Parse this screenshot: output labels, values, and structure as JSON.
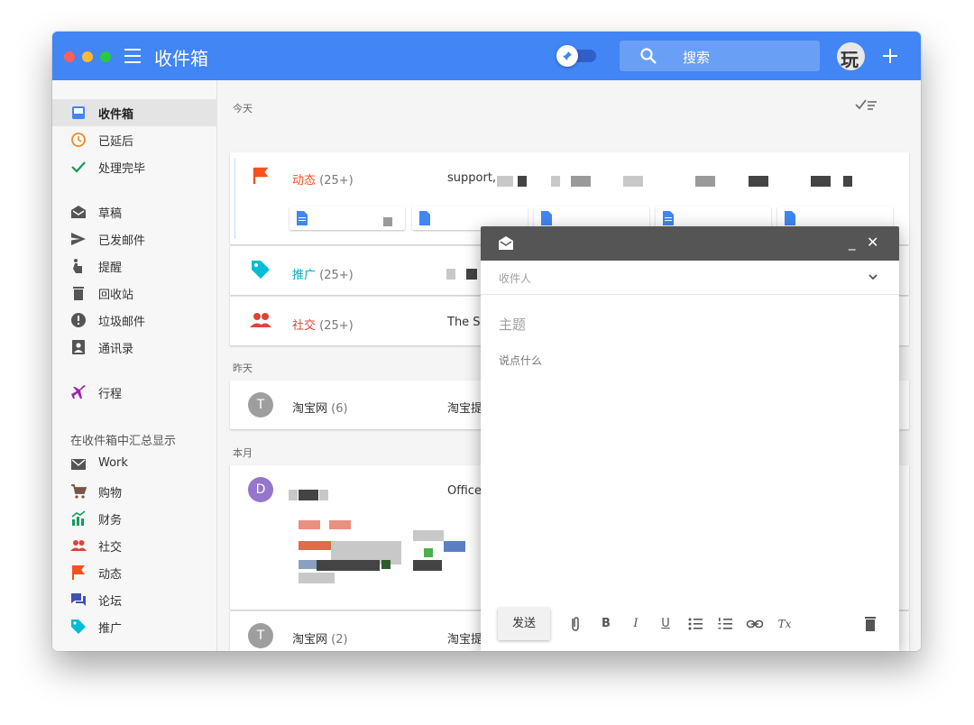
{
  "header": {
    "title": "收件箱",
    "search_placeholder": "搜索",
    "avatar_text": "玩"
  },
  "sidebar": {
    "items": [
      {
        "label": "收件箱",
        "icon": "inbox-icon",
        "color": "#4285f4"
      },
      {
        "label": "已延后",
        "icon": "clock-icon",
        "color": "#ef8a24"
      },
      {
        "label": "处理完毕",
        "icon": "check-icon",
        "color": "#0f9d58"
      },
      {
        "label": "草稿",
        "icon": "drafts-icon",
        "color": "#555555"
      },
      {
        "label": "已发邮件",
        "icon": "send-icon",
        "color": "#555555"
      },
      {
        "label": "提醒",
        "icon": "reminder-icon",
        "color": "#555555"
      },
      {
        "label": "回收站",
        "icon": "trash-icon",
        "color": "#555555"
      },
      {
        "label": "垃圾邮件",
        "icon": "spam-icon",
        "color": "#555555"
      },
      {
        "label": "通讯录",
        "icon": "contacts-icon",
        "color": "#555555"
      },
      {
        "label": "行程",
        "icon": "plane-icon",
        "color": "#9c27b0"
      }
    ],
    "bundle_heading": "在收件箱中汇总显示",
    "bundles": [
      {
        "label": "Work",
        "icon": "mail-icon",
        "color": "#555555"
      },
      {
        "label": "购物",
        "icon": "cart-icon",
        "color": "#795548"
      },
      {
        "label": "财务",
        "icon": "finance-icon",
        "color": "#0f9d58"
      },
      {
        "label": "社交",
        "icon": "social-icon",
        "color": "#db4437"
      },
      {
        "label": "动态",
        "icon": "flag-icon",
        "color": "#f4511e"
      },
      {
        "label": "论坛",
        "icon": "forum-icon",
        "color": "#3f51b5"
      },
      {
        "label": "推广",
        "icon": "tag-icon",
        "color": "#00bcd4"
      }
    ]
  },
  "main": {
    "today_label": "今天",
    "yesterday_label": "昨天",
    "month_label": "本月",
    "rows": [
      {
        "name": "动态",
        "count": "(25+)",
        "sender": "support,",
        "name_color": "#f4511e"
      },
      {
        "name": "推广",
        "count": "(25+)",
        "sender": "",
        "name_color": "#00acc1"
      },
      {
        "name": "社交",
        "count": "(25+)",
        "sender": "The So",
        "name_color": "#db4437"
      },
      {
        "name": "淘宝网",
        "count": "(6)",
        "sender": "淘宝提",
        "avatar": "T"
      },
      {
        "name": "",
        "count": "",
        "sender": "Office",
        "avatar": "D"
      },
      {
        "name": "淘宝网",
        "count": "(2)",
        "sender": "淘宝提",
        "avatar": "T"
      }
    ]
  },
  "compose": {
    "to_placeholder": "收件人",
    "subject_placeholder": "主题",
    "body_placeholder": "说点什么",
    "send_label": "发送",
    "minimize": "_",
    "close": "✕",
    "tools": {
      "bold": "B",
      "italic": "I",
      "underline": "U",
      "clear": "Tx"
    }
  }
}
